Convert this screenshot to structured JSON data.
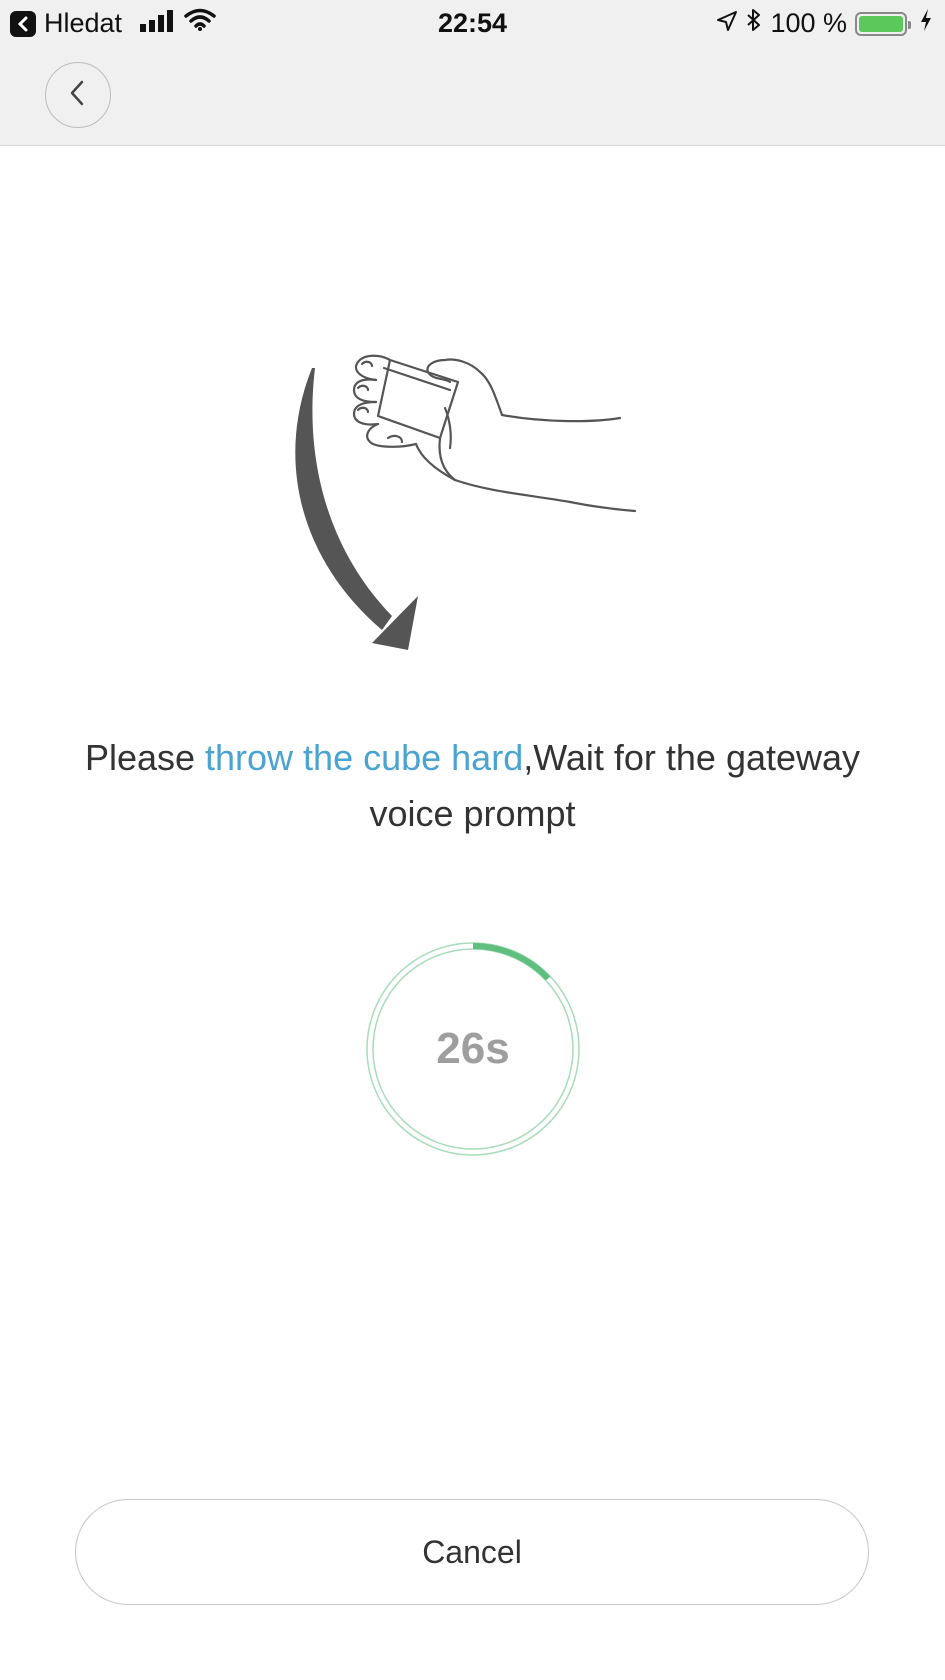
{
  "status_bar": {
    "back_app_label": "Hledat",
    "time": "22:54",
    "battery_text": "100 %",
    "battery_level": 1.0,
    "icons": [
      "back-app-icon",
      "signal-icon",
      "wifi-icon",
      "location-icon",
      "bluetooth-icon",
      "battery-icon",
      "charging-icon"
    ]
  },
  "nav": {
    "back_icon": "chevron-left-icon"
  },
  "instruction": {
    "prefix": "Please ",
    "highlight": "throw the cube hard",
    "suffix": ",Wait for the gateway voice prompt"
  },
  "timer": {
    "label": "26s",
    "progress": 0.13
  },
  "actions": {
    "cancel_label": "Cancel"
  },
  "colors": {
    "accent_link": "#4aa3d0",
    "timer_progress": "#5fbf7f",
    "timer_track": "#a8dcbb",
    "arrow": "#555555"
  }
}
